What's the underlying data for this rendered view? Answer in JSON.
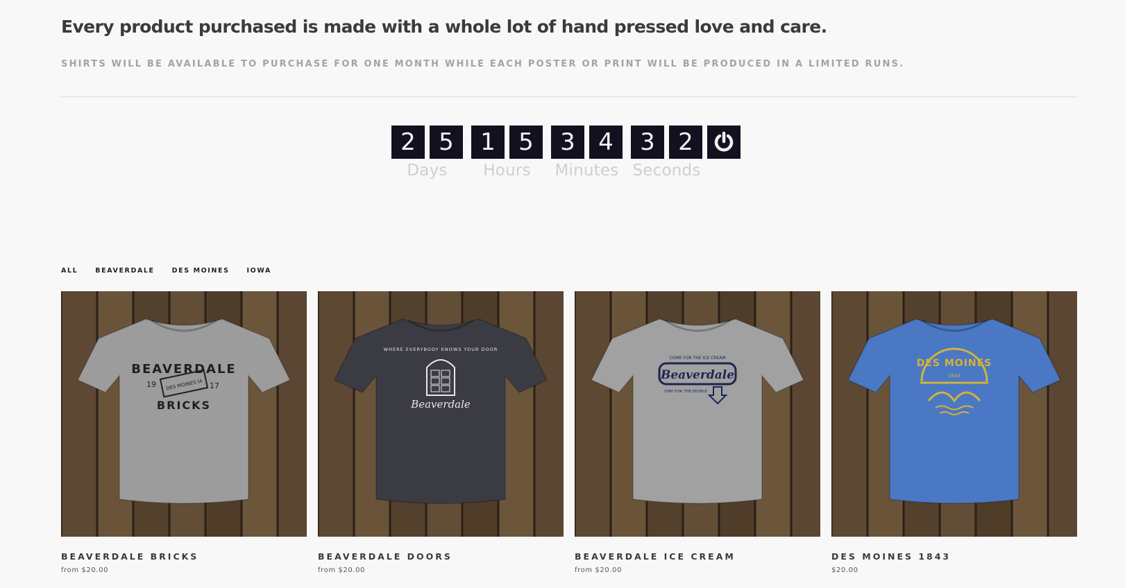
{
  "intro": {
    "headline": "Every product purchased is made with a whole lot of hand pressed love and care.",
    "subline": "SHIRTS WILL BE AVAILABLE TO PURCHASE FOR ONE MONTH WHILE EACH POSTER OR PRINT WILL BE PRODUCED IN A LIMITED RUNS."
  },
  "countdown": {
    "days": [
      "2",
      "5"
    ],
    "hours": [
      "1",
      "5"
    ],
    "minutes": [
      "3",
      "4"
    ],
    "seconds": [
      "3",
      "2"
    ],
    "labels": {
      "days": "Days",
      "hours": "Hours",
      "minutes": "Minutes",
      "seconds": "Seconds"
    },
    "icon": "power-icon"
  },
  "filters": [
    "ALL",
    "BEAVERDALE",
    "DES MOINES",
    "IOWA"
  ],
  "products": [
    {
      "title": "BEAVERDALE BRICKS",
      "price": "from $20.00",
      "shirt_color": "#9c9c9c",
      "print_color": "#1f1f25",
      "graphic": "bricks",
      "graphic_text": [
        "BEAVERDALE",
        "19",
        "17",
        "BRICKS",
        "DES MOINES IA"
      ]
    },
    {
      "title": "BEAVERDALE DOORS",
      "price": "from $20.00",
      "shirt_color": "#3b3b44",
      "print_color": "#e8e8e8",
      "graphic": "doors",
      "graphic_text": [
        "WHERE EVERYBODY KNOWS YOUR DOOR",
        "Beaverdale"
      ]
    },
    {
      "title": "BEAVERDALE ICE CREAM",
      "price": "from $20.00",
      "shirt_color": "#a1a1a1",
      "print_color": "#1d2554",
      "graphic": "icecream",
      "graphic_text": [
        "COME FOR THE ICE CREAM",
        "Beaverdale",
        "STAY FOR THE PEOPLE"
      ]
    },
    {
      "title": "DES MOINES 1843",
      "price": "$20.00",
      "shirt_color": "#4a78c4",
      "print_color": "#d4b23a",
      "graphic": "desmoines",
      "graphic_text": [
        "DES MOINES",
        "1843"
      ]
    }
  ],
  "colors": {
    "timer_bg": "#13111f",
    "timer_label": "#cfcfcf",
    "page_bg": "#f8f8f8",
    "wood": "#5a4631"
  }
}
